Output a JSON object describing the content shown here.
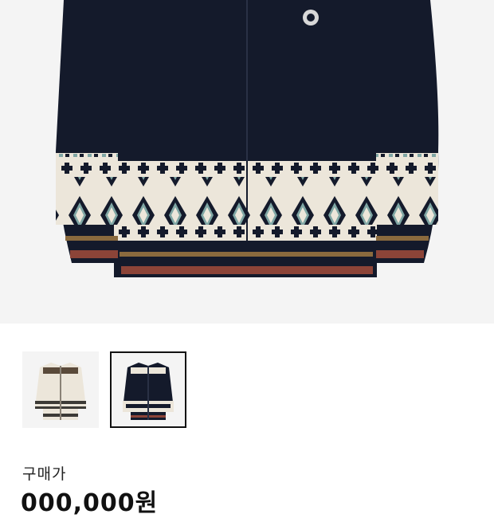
{
  "product": {
    "main_image": {
      "icon": "navy-fair-isle-zip-cardigan"
    },
    "thumbnails": [
      {
        "icon": "ivory-fair-isle-zip-cardigan",
        "selected": false
      },
      {
        "icon": "navy-fair-isle-zip-cardigan",
        "selected": true
      }
    ],
    "price_label": "구매가",
    "price_value": "000,000원"
  },
  "colors": {
    "navy": "#141a2b",
    "ivory": "#ece6da",
    "teal": "#7fa6a4",
    "brown": "#8a6a3e",
    "rust": "#8c4438",
    "background": "#f4f4f4"
  }
}
